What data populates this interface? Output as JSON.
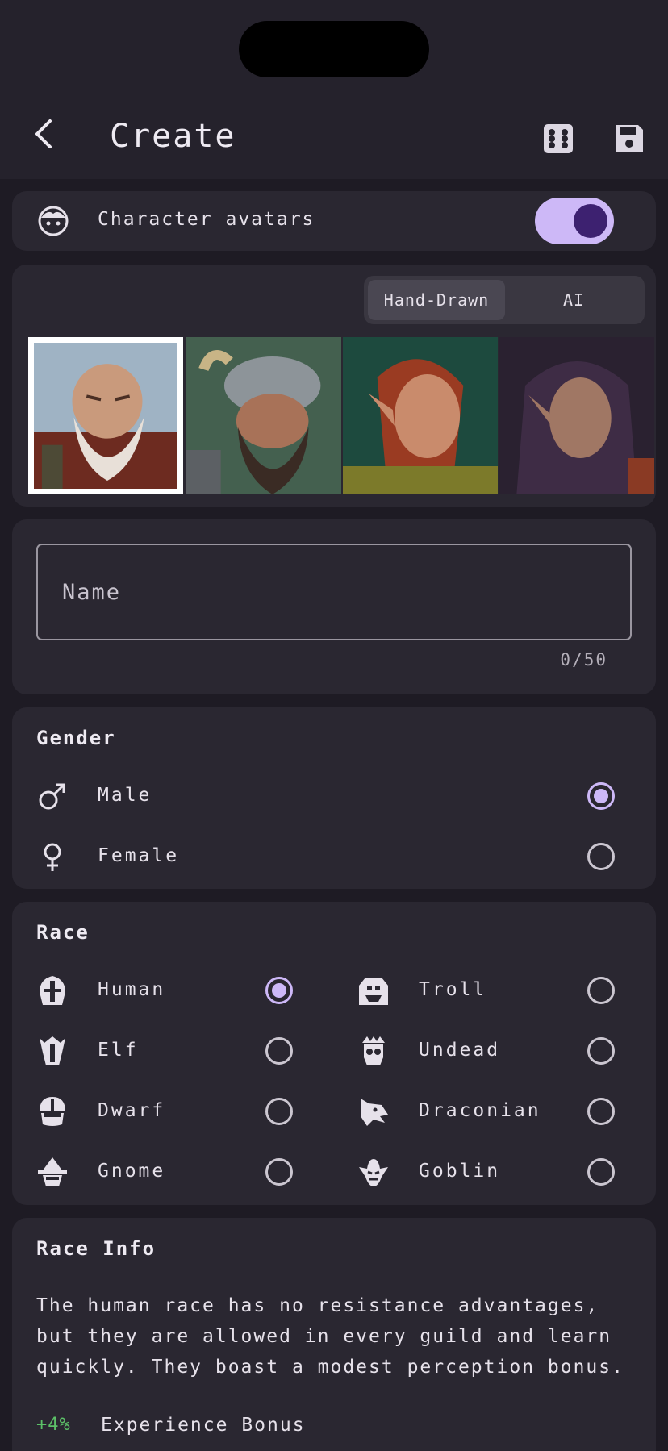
{
  "header": {
    "title": "Create",
    "back_icon": "chevron-left-icon",
    "dice_icon": "dice-icon",
    "save_icon": "floppy-disk-icon"
  },
  "avatars_toggle": {
    "label": "Character avatars",
    "enabled": true,
    "icon": "face-icon"
  },
  "avatar_style": {
    "options": [
      "Hand-Drawn",
      "AI"
    ],
    "selected": "Hand-Drawn"
  },
  "portraits": {
    "selected_index": 0,
    "items": [
      "dwarf-bald-portrait",
      "dwarf-horned-helm-portrait",
      "elf-red-hair-portrait",
      "elf-dark-hair-portrait"
    ]
  },
  "name_field": {
    "placeholder": "Name",
    "value": "",
    "counter": "0/50"
  },
  "gender": {
    "title": "Gender",
    "options": [
      {
        "label": "Male",
        "icon": "male-symbol-icon",
        "selected": true
      },
      {
        "label": "Female",
        "icon": "female-symbol-icon",
        "selected": false
      }
    ]
  },
  "race": {
    "title": "Race",
    "options": [
      {
        "label": "Human",
        "icon": "human-helmet-icon",
        "selected": true
      },
      {
        "label": "Troll",
        "icon": "troll-icon",
        "selected": false
      },
      {
        "label": "Elf",
        "icon": "elf-helmet-icon",
        "selected": false
      },
      {
        "label": "Undead",
        "icon": "skull-crown-icon",
        "selected": false
      },
      {
        "label": "Dwarf",
        "icon": "dwarf-helmet-icon",
        "selected": false
      },
      {
        "label": "Draconian",
        "icon": "dragon-head-icon",
        "selected": false
      },
      {
        "label": "Gnome",
        "icon": "gnome-icon",
        "selected": false
      },
      {
        "label": "Goblin",
        "icon": "goblin-icon",
        "selected": false
      }
    ]
  },
  "race_info": {
    "title": "Race Info",
    "description": "The human race has no resistance advantages, but they are allowed in every guild and learn quickly. They boast a modest perception bonus.",
    "bonuses": [
      {
        "value": "+4%",
        "label": "Experience Bonus"
      }
    ]
  },
  "colors": {
    "background": "#1e1b24",
    "card": "#2a2731",
    "accent": "#cdb8f7",
    "toggle_knob": "#3d2170",
    "bonus_positive": "#5cc068"
  }
}
